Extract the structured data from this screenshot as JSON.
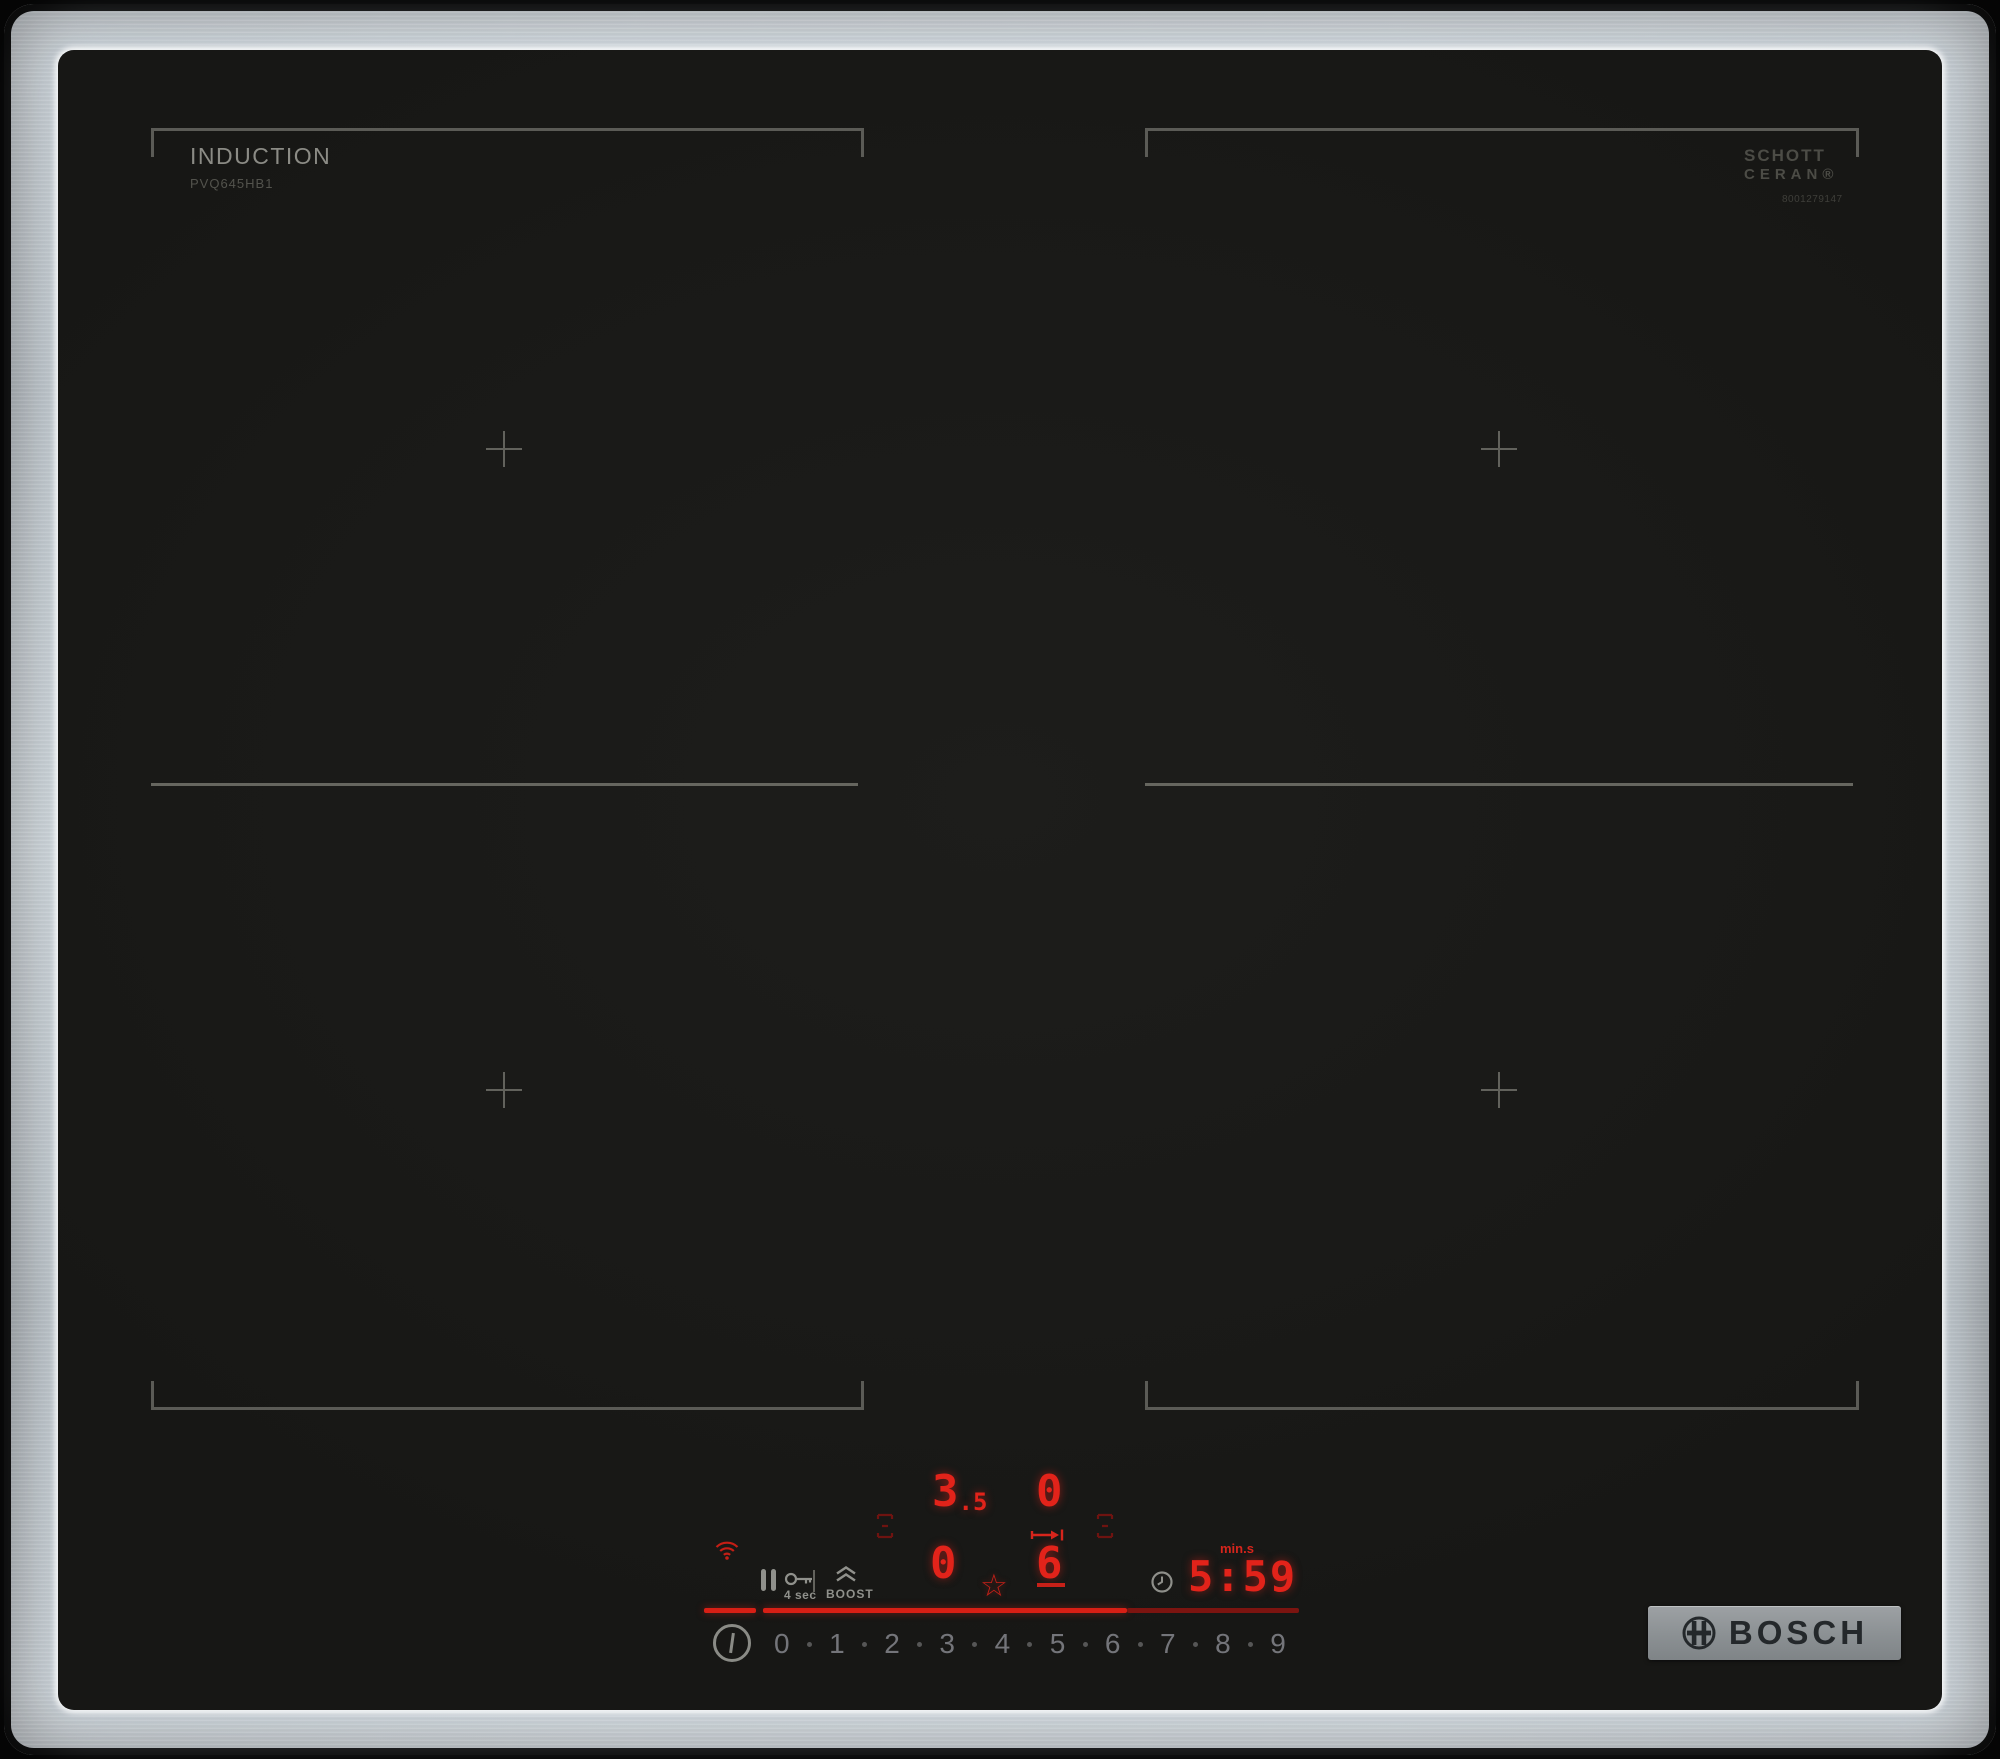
{
  "labels": {
    "induction": "INDUCTION",
    "model": "PVQ645HB1",
    "schott_line1": "SCHOTT",
    "schott_line2": "CERAN®",
    "schott_serial": "8001279147",
    "bosch": "BOSCH"
  },
  "control_panel": {
    "zones": {
      "back_left_level": "3",
      "back_left_decimal": ".5",
      "back_right_level": "0",
      "front_left_level": "0",
      "front_right_level": "6"
    },
    "timer": {
      "unit_label": "min.s",
      "value": "5:59"
    },
    "childlock_label": "4 sec",
    "boost_label": "BOOST",
    "star_glyph": "☆",
    "slider": {
      "numbers": [
        "0",
        "1",
        "2",
        "3",
        "4",
        "5",
        "6",
        "7",
        "8",
        "9"
      ],
      "active_level": 6
    },
    "icons": {
      "wifi": "wifi-icon",
      "pause": "pause-icon",
      "childlock": "key-icon",
      "boost": "boost-chevrons-icon",
      "clock": "timer-clock-icon",
      "favorite": "star-icon",
      "move_pan": "move-pan-arrow-icon",
      "power": "power-icon",
      "flex_zone": "flex-zone-indicator-icon"
    }
  },
  "colors": {
    "led_red": "#e2231a",
    "led_dim_red": "#7c1410",
    "glass_black": "#1a1a18",
    "steel": "#b9bec1",
    "zone_line_gray": "#5b5b56",
    "control_gray": "#90918c"
  }
}
